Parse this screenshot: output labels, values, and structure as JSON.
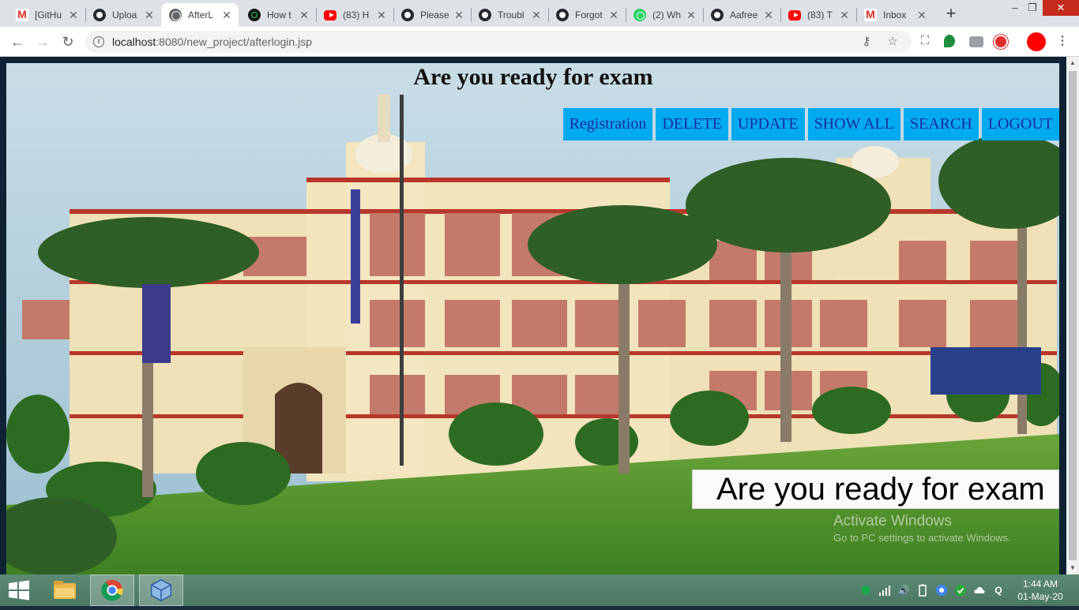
{
  "browser": {
    "tabs": [
      {
        "title": "[GitHu",
        "icon": "gmail-icon",
        "active": false
      },
      {
        "title": "Uploa",
        "icon": "github-icon",
        "active": false
      },
      {
        "title": "AfterL",
        "icon": "globe-icon",
        "active": true
      },
      {
        "title": "How t",
        "icon": "power-icon",
        "active": false
      },
      {
        "title": "(83) H",
        "icon": "youtube-icon",
        "active": false
      },
      {
        "title": "Please",
        "icon": "github-icon",
        "active": false
      },
      {
        "title": "Troubl",
        "icon": "github-icon",
        "active": false
      },
      {
        "title": "Forgot",
        "icon": "github-icon",
        "active": false
      },
      {
        "title": "(2) Wh",
        "icon": "whatsapp-icon",
        "active": false
      },
      {
        "title": "Aafree",
        "icon": "github-icon",
        "active": false
      },
      {
        "title": "(83) T",
        "icon": "youtube-icon",
        "active": false
      },
      {
        "title": "Inbox",
        "icon": "gmail-icon",
        "active": false
      }
    ],
    "new_tab": "+",
    "url_host": "localhost",
    "url_path": ":8080/new_project/afterlogin.jsp"
  },
  "page": {
    "heading": "Are you ready for exam",
    "nav": [
      "Registration",
      "DELETE",
      "UPDATE",
      "SHOW ALL",
      "SEARCH",
      "LOGOUT"
    ],
    "marquee": "Are you ready for exam"
  },
  "watermark": {
    "line1": "Activate Windows",
    "line2": "Go to PC settings to activate Windows."
  },
  "taskbar": {
    "time": "1:44 AM",
    "date": "01-May-20"
  },
  "colors": {
    "nav_bg": "#00aaf0",
    "nav_text": "#1f2c9c",
    "taskbar": "#4f7b66"
  }
}
